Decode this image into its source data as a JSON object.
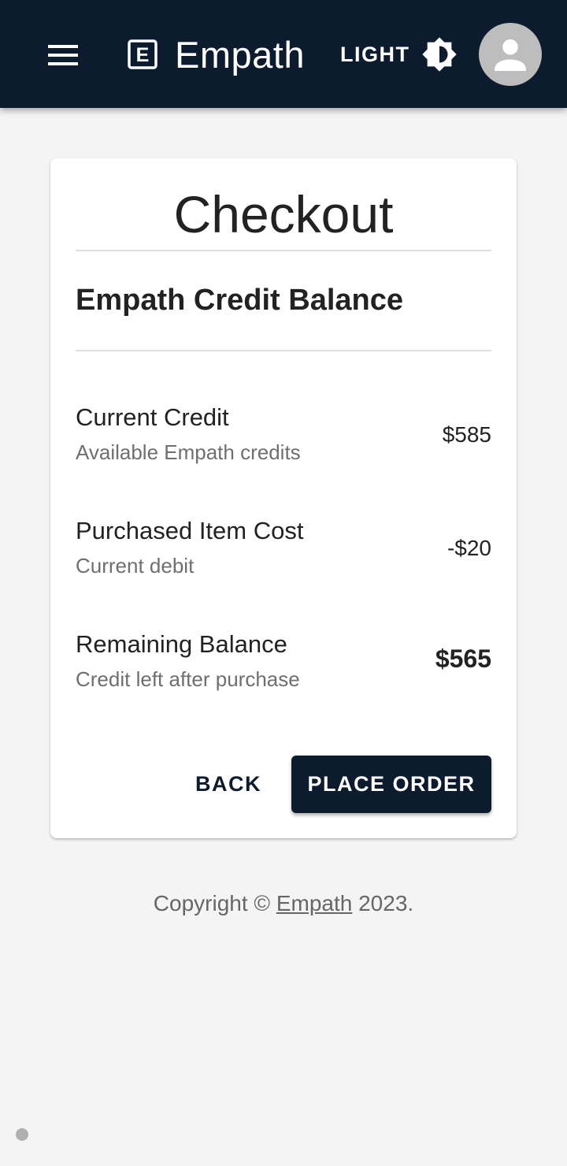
{
  "header": {
    "app_name": "Empath",
    "logo_letter": "E",
    "theme_toggle_label": "LIGHT",
    "background_color": "#0d1b2e"
  },
  "checkout": {
    "title": "Checkout",
    "section_heading": "Empath Credit Balance",
    "rows": [
      {
        "label": "Current Credit",
        "description": "Available Empath credits",
        "value": "$585"
      },
      {
        "label": "Purchased Item Cost",
        "description": "Current debit",
        "value": "-$20"
      },
      {
        "label": "Remaining Balance",
        "description": "Credit left after purchase",
        "value": "$565"
      }
    ],
    "back_label": "BACK",
    "place_order_label": "PLACE ORDER"
  },
  "footer": {
    "prefix": "Copyright © ",
    "link_text": "Empath",
    "suffix": " 2023."
  },
  "icons": {
    "menu": "menu-icon",
    "logo": "logo-e-icon",
    "theme": "brightness-icon",
    "avatar": "account-icon"
  }
}
